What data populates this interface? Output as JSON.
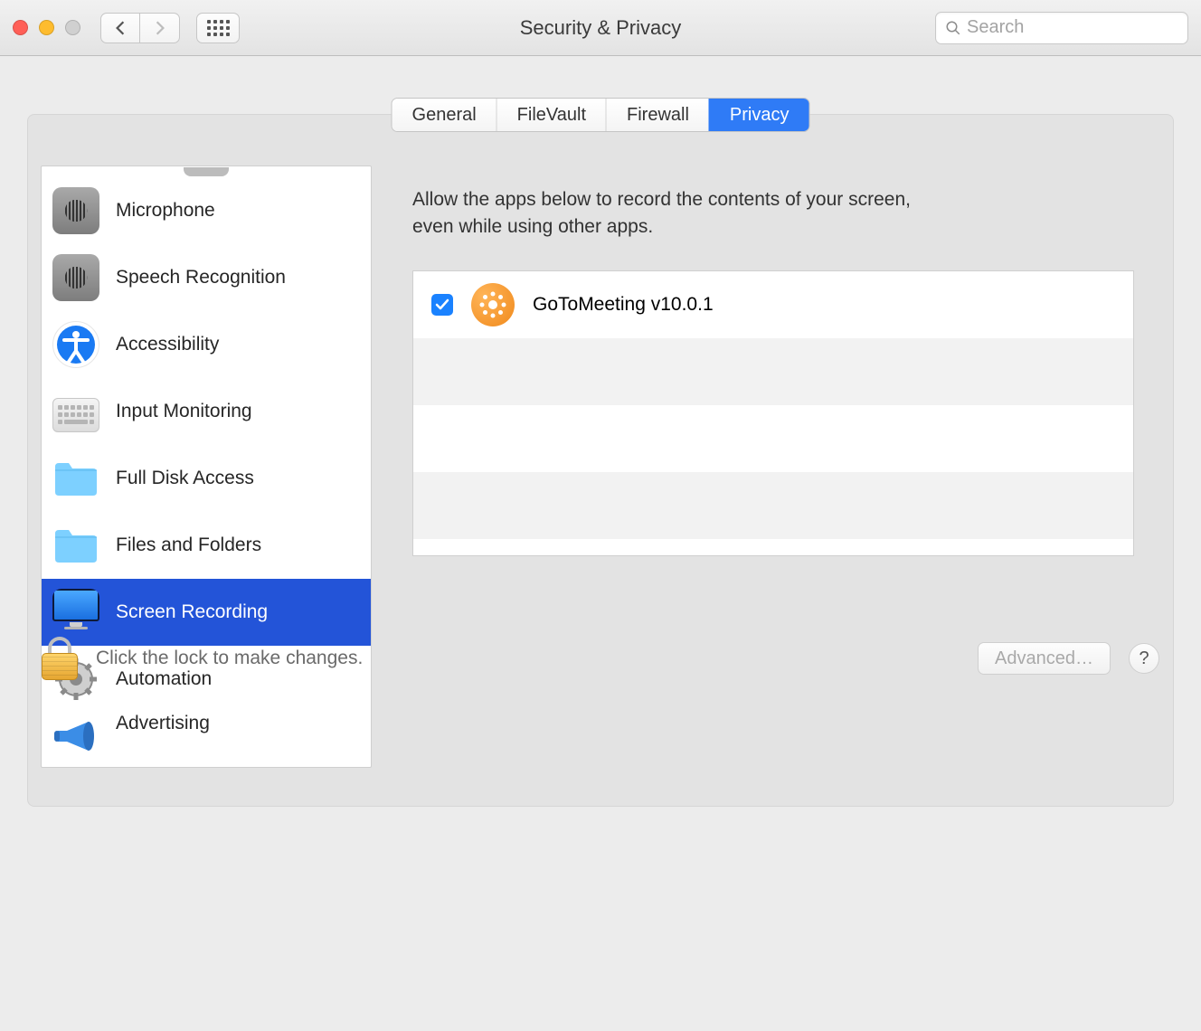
{
  "window": {
    "title": "Security & Privacy"
  },
  "toolbar": {
    "search_placeholder": "Search"
  },
  "tabs": {
    "general": "General",
    "filevault": "FileVault",
    "firewall": "Firewall",
    "privacy": "Privacy"
  },
  "sidebar": {
    "items": [
      {
        "label": "Microphone"
      },
      {
        "label": "Speech Recognition"
      },
      {
        "label": "Accessibility"
      },
      {
        "label": "Input Monitoring"
      },
      {
        "label": "Full Disk Access"
      },
      {
        "label": "Files and Folders"
      },
      {
        "label": "Screen Recording"
      },
      {
        "label": "Automation"
      },
      {
        "label": "Advertising"
      }
    ],
    "selected_index": 6
  },
  "detail": {
    "description": "Allow the apps below to record the contents of your screen, even while using other apps.",
    "apps": [
      {
        "name": "GoToMeeting v10.0.1",
        "checked": true
      }
    ]
  },
  "footer": {
    "lock_hint": "Click the lock to make changes.",
    "advanced_label": "Advanced…",
    "help_label": "?"
  }
}
